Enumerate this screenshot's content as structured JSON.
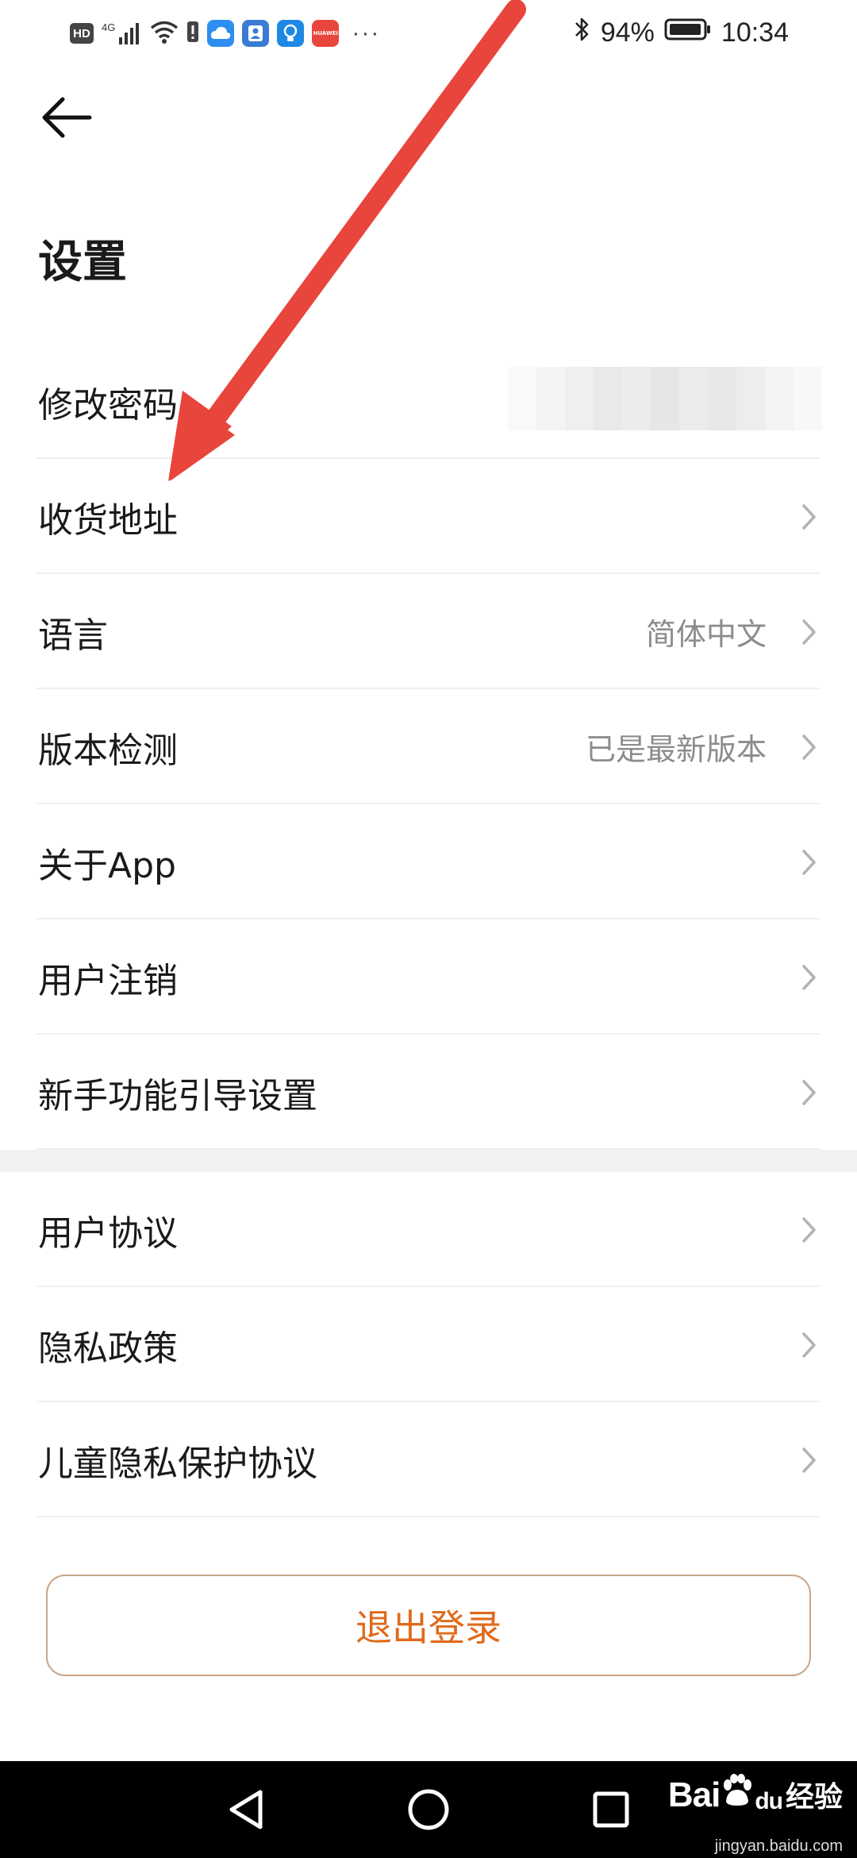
{
  "status_bar": {
    "hd_label": "HD",
    "network_label": "4G",
    "battery_percent": "94%",
    "time": "10:34",
    "overflow_label": "···",
    "app_icons": [
      "cloud-icon",
      "contacts-icon",
      "bulb-icon",
      "huawei-icon"
    ]
  },
  "header": {
    "title": "设置"
  },
  "settings_group_1": [
    {
      "label": "修改密码",
      "value": ""
    },
    {
      "label": "收货地址",
      "value": ""
    },
    {
      "label": "语言",
      "value": "简体中文"
    },
    {
      "label": "版本检测",
      "value": "已是最新版本"
    },
    {
      "label": "关于App",
      "value": ""
    },
    {
      "label": "用户注销",
      "value": ""
    },
    {
      "label": "新手功能引导设置",
      "value": ""
    }
  ],
  "settings_group_2": [
    {
      "label": "用户协议"
    },
    {
      "label": "隐私政策"
    },
    {
      "label": "儿童隐私保护协议"
    }
  ],
  "logout_label": "退出登录",
  "watermark": {
    "brand": "Bai",
    "brand_suffix": "du",
    "text": "经验",
    "url": "jingyan.baidu.com"
  },
  "colors": {
    "accent": "#e06a1b",
    "logout_border": "#c9a686",
    "annotation_arrow": "#e8453c"
  }
}
